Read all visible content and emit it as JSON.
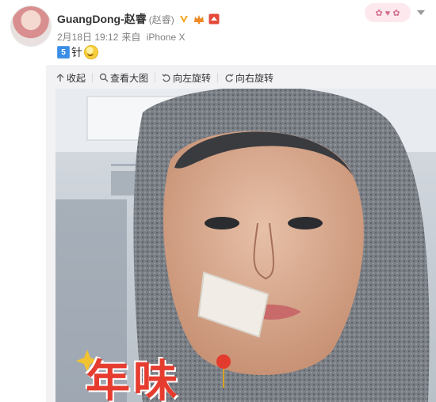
{
  "post": {
    "author": "GuangDong-赵睿",
    "remark": "(赵睿)",
    "timestamp": "2月18日 19:12",
    "source_prefix": "来自",
    "source": "iPhone X",
    "text_number": "5",
    "text_suffix": "针",
    "colors": {
      "accent": "#ea8010",
      "badge_blue": "#3b8ee5",
      "brand_red": "#e44a3a"
    }
  },
  "toolbar": {
    "items": [
      "收起",
      "查看大图",
      "向左旋转",
      "向右旋转"
    ]
  },
  "overlay": {
    "text": "年味"
  },
  "icons": {
    "collapse": "arrow-up-icon",
    "view": "search-icon",
    "rotate_left": "rotate-left-icon",
    "rotate_right": "rotate-right-icon",
    "menu": "chevron-down-icon"
  }
}
